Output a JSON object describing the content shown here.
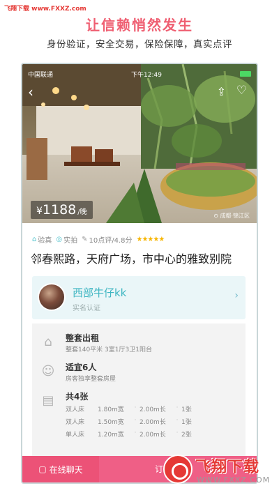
{
  "watermark_top": "飞翔下载 www.FXXZ.com",
  "headline": "让信赖悄然发生",
  "subheadline": "身份验证，安全交易，保险保障，真实点评",
  "status_bar": {
    "carrier": "中国联通",
    "time": "下午12:49",
    "battery": ""
  },
  "listing": {
    "price_currency": "¥",
    "price_value": "1188",
    "price_unit": "/晚",
    "location": "成都·锦江区",
    "tags": [
      {
        "icon": "verified-icon",
        "label": "验真"
      },
      {
        "icon": "camera-icon",
        "label": "实拍"
      },
      {
        "icon": "comment-icon",
        "label": "10点评/4.8分"
      }
    ],
    "stars": "★★★★★",
    "title": "邻春熙路，天府广场，市中心的雅致别院"
  },
  "host": {
    "name": "西部牛仔kk",
    "verify": "实名认证"
  },
  "details": {
    "rent_type_title": "整套出租",
    "rent_type_sub": "整套140平米 3室1厅3卫1阳台",
    "guests_title": "适宜6人",
    "guests_sub": "房客独享整套房屋",
    "beds_title": "共4张",
    "beds": [
      {
        "type": "双人床",
        "width": "1.80m宽",
        "length": "2.00m长",
        "count": "1张"
      },
      {
        "type": "双人床",
        "width": "1.50m宽",
        "length": "2.00m长",
        "count": "1张"
      },
      {
        "type": "单人床",
        "width": "1.20m宽",
        "length": "2.00m长",
        "count": "2张"
      }
    ]
  },
  "bottom_bar": {
    "chat_label": "在线聊天",
    "book_label": "订"
  },
  "watermark_bottom": {
    "brand": "飞翔下载",
    "url": "WWW.FXXZ.COM"
  },
  "colors": {
    "accent_pink": "#ef5f86",
    "accent_teal": "#3fb6c2",
    "star": "#f7b500"
  }
}
